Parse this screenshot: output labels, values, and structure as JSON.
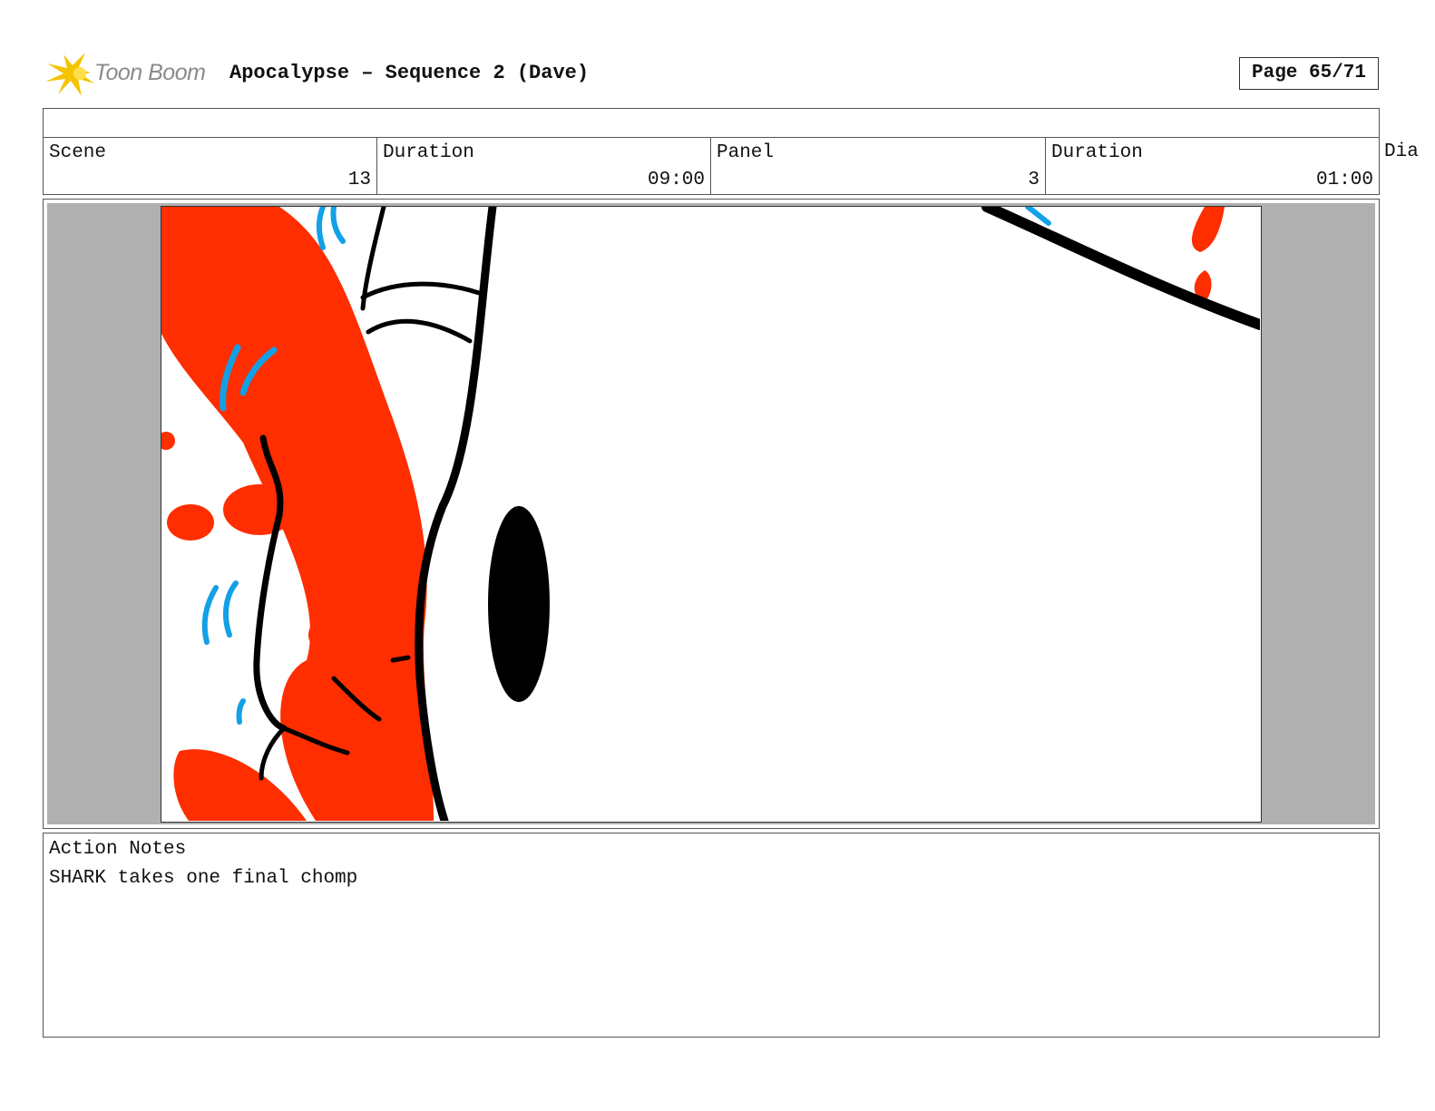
{
  "header": {
    "logo_text": "Toon Boom",
    "title": "Apocalypse – Sequence 2 (Dave)",
    "page": "Page 65/71"
  },
  "info": {
    "scene_label": "Scene",
    "scene_value": "13",
    "scene_duration_label": "Duration",
    "scene_duration_value": "09:00",
    "panel_label": "Panel",
    "panel_value": "3",
    "panel_duration_label": "Duration",
    "panel_duration_value": "01:00",
    "dialog_label_partial": "Dia"
  },
  "notes": {
    "label": "Action Notes",
    "text": "SHARK takes one final chomp"
  },
  "colors": {
    "red": "#ff2e00",
    "blue": "#12a0e6",
    "ink": "#000000",
    "letterbox": "#b0b0b0",
    "logo_star": "#f5c400"
  },
  "icons": [
    "toon-boom-star-logo-icon"
  ]
}
